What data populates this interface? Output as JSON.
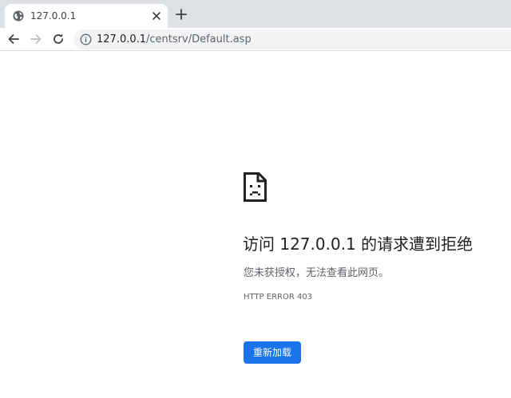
{
  "tab": {
    "title": "127.0.0.1",
    "favicon": "globe-icon",
    "close_icon": "close-icon"
  },
  "new_tab_icon": "plus-icon",
  "toolbar": {
    "back_icon": "arrow-left-icon",
    "forward_icon": "arrow-right-icon",
    "reload_icon": "reload-icon",
    "site_info_icon": "info-icon",
    "url_host": "127.0.0.1",
    "url_path": "/centsrv/Default.asp"
  },
  "error": {
    "icon": "sad-page-icon",
    "title": "访问 127.0.0.1 的请求遭到拒绝",
    "description": "您未获授权，无法查看此网页。",
    "code": "HTTP ERROR 403",
    "reload_label": "重新加载"
  },
  "colors": {
    "tabstrip": "#dee1e6",
    "omnibox": "#f1f3f4",
    "button": "#1a73e8",
    "text_primary": "#202124",
    "text_secondary": "#5f6368"
  }
}
